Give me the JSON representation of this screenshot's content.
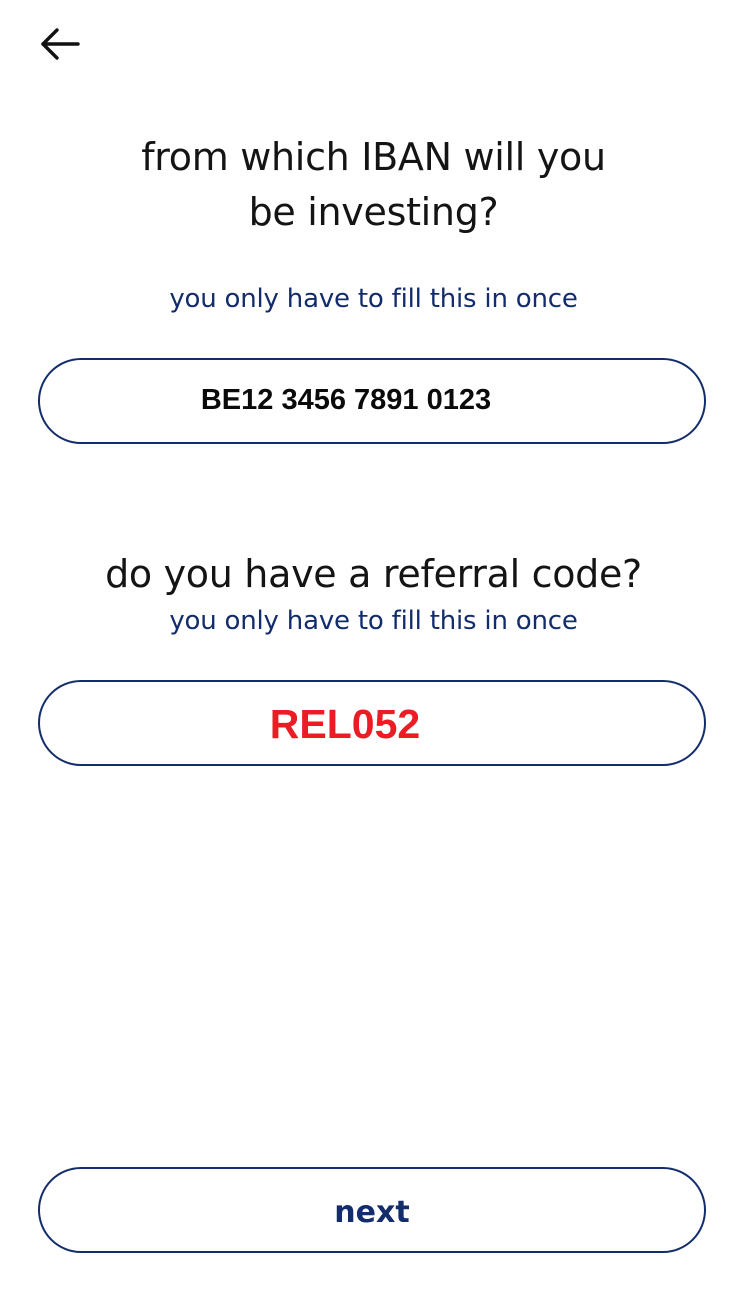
{
  "header": {
    "back_icon": "arrow-left-icon"
  },
  "iban_section": {
    "title": "from which IBAN will you be investing?",
    "hint": "you only have to fill this in once",
    "value": "BE12 3456 7891 0123"
  },
  "referral_section": {
    "title": "do you have a referral code?",
    "hint": "you only have to fill this in once",
    "value": "REL052",
    "value_color": "#ec1c24"
  },
  "footer": {
    "next_label": "next"
  },
  "colors": {
    "accent": "#132c6b",
    "text": "#141414",
    "background": "#ffffff"
  }
}
